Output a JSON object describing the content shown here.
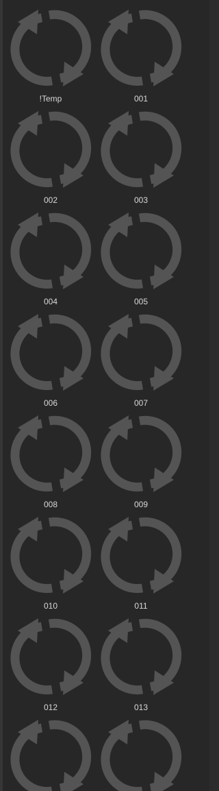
{
  "panel": {
    "icon": "refresh-icon",
    "icon_color": "#545454",
    "label_color": "#d8d8d8",
    "items": [
      {
        "label": "!Temp"
      },
      {
        "label": "001"
      },
      {
        "label": "002"
      },
      {
        "label": "003"
      },
      {
        "label": "004"
      },
      {
        "label": "005"
      },
      {
        "label": "006"
      },
      {
        "label": "007"
      },
      {
        "label": "008"
      },
      {
        "label": "009"
      },
      {
        "label": "010"
      },
      {
        "label": "011"
      },
      {
        "label": "012"
      },
      {
        "label": "013"
      },
      {
        "label": ""
      },
      {
        "label": ""
      }
    ]
  }
}
